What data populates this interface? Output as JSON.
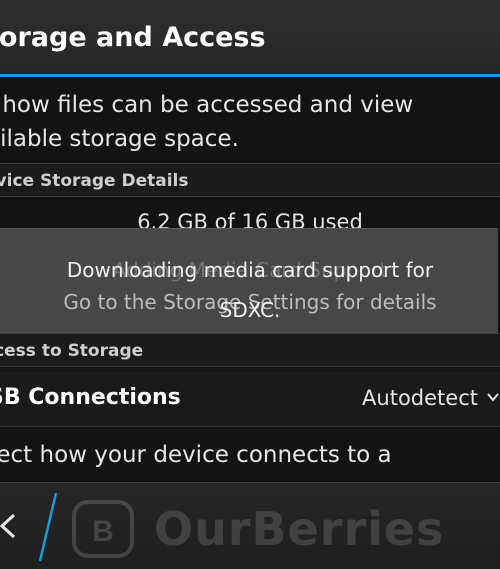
{
  "header": {
    "title": "torage and Access"
  },
  "description": {
    "line1": "t how files can be accessed and view",
    "line2": "ailable storage space."
  },
  "device_storage": {
    "header": "evice Storage Details",
    "used_text": "6.2 GB of 16 GB used"
  },
  "toast": {
    "line1": "Downloading media card support for",
    "line2": "Go to the Storage Settings for details",
    "line3": "SDXC."
  },
  "ghost": {
    "text": "Adding Media Card Support"
  },
  "access_storage": {
    "header": "ccess to Storage"
  },
  "usb": {
    "label": "SB Connections",
    "value": "Autodetect",
    "description": "lect how your device connects to a"
  },
  "watermark": {
    "text": "OurBerries"
  },
  "icons": {
    "back": "chevron-left-icon",
    "dropdown": "chevron-down-icon",
    "logo": "blackberry-logo-icon"
  },
  "colors": {
    "accent": "#1c9ad6",
    "background": "#131313",
    "toast": "#4a4a4a"
  }
}
